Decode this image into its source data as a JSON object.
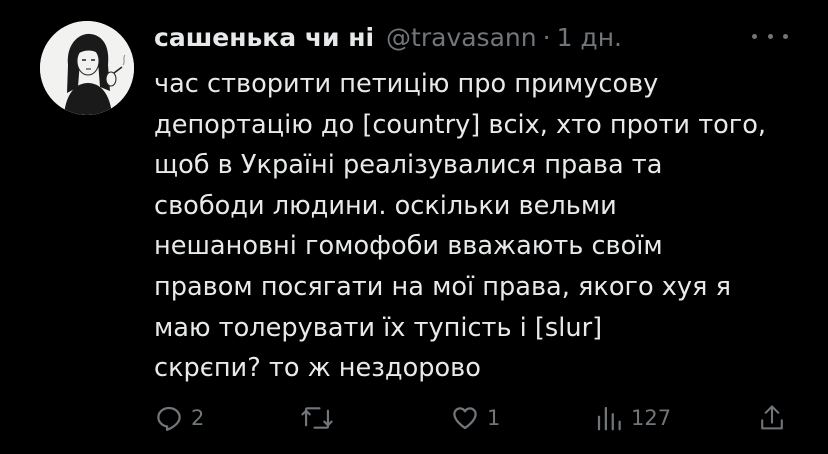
{
  "tweet": {
    "author_name": "сашенька чи ні",
    "handle": "@travasann",
    "separator": "·",
    "time": "1 дн.",
    "text_lines": [
      "час створити петицію про примусову",
      "депортацію до [country] всіх, хто проти того,",
      "щоб в Україні реалізувалися права та",
      "свободи людини. оскільки вельми",
      "нешановні гомофоби вважають своїм",
      "правом посягати на мої права, якого хуя я",
      "маю толерувати їх тупість і [slur]",
      "скрєпи? то ж нездорово"
    ]
  },
  "actions": {
    "reply_count": "2",
    "retweet_count": "",
    "like_count": "1",
    "views_count": "127"
  },
  "icons": {
    "avatar": "avatar-drawing",
    "more": "more-options-icon",
    "reply": "reply-icon",
    "retweet": "retweet-icon",
    "like": "heart-icon",
    "views": "views-chart-icon",
    "share": "share-icon"
  },
  "colors": {
    "background": "#000000",
    "primary_text": "#e7e9ea",
    "secondary_text": "#71767b"
  }
}
